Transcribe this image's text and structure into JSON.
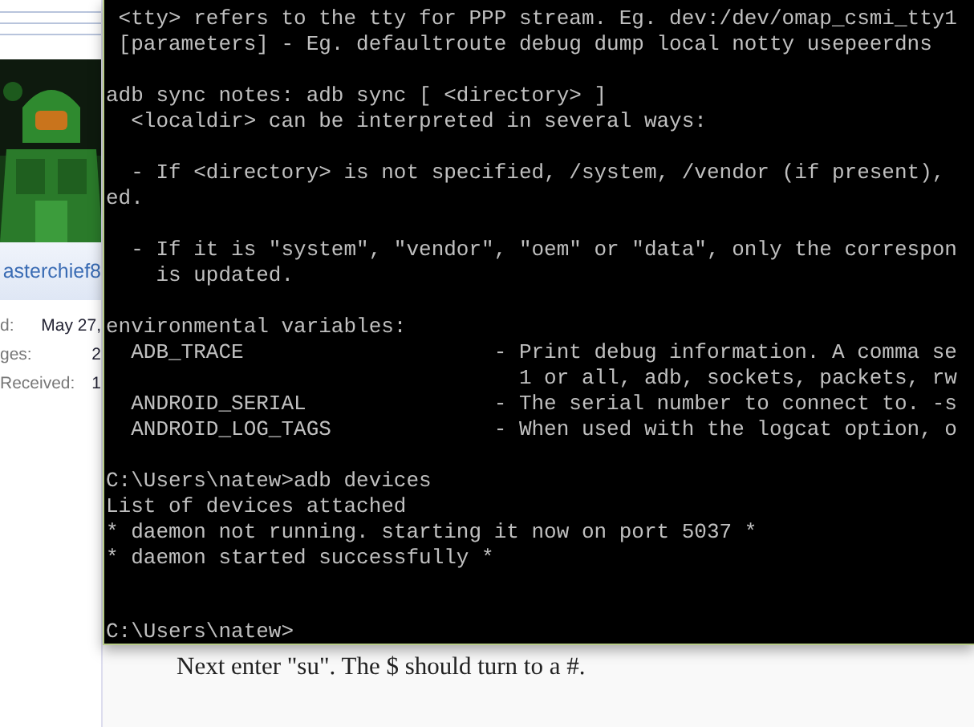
{
  "forum_sidebar": {
    "username": "asterchief8",
    "stats": [
      {
        "label": "d:",
        "value": "May 27,"
      },
      {
        "label": "ges:",
        "value": "2"
      },
      {
        "label": "Received:",
        "value": "1"
      }
    ]
  },
  "terminal": {
    "blocks": [
      [
        " <tty> refers to the tty for PPP stream. Eg. dev:/dev/omap_csmi_tty1",
        " [parameters] - Eg. defaultroute debug dump local notty usepeerdns"
      ],
      [
        "adb sync notes: adb sync [ <directory> ]",
        "  <localdir> can be interpreted in several ways:"
      ],
      [
        "  - If <directory> is not specified, /system, /vendor (if present),",
        "ed."
      ],
      [
        "  - If it is \"system\", \"vendor\", \"oem\" or \"data\", only the correspon",
        "    is updated."
      ],
      [
        "environmental variables:",
        "  ADB_TRACE                    - Print debug information. A comma se",
        "                                 1 or all, adb, sockets, packets, rw",
        "  ANDROID_SERIAL               - The serial number to connect to. -s",
        "  ANDROID_LOG_TAGS             - When used with the logcat option, o"
      ],
      [
        "C:\\Users\\natew>adb devices",
        "List of devices attached",
        "* daemon not running. starting it now on port 5037 *",
        "* daemon started successfully *"
      ]
    ],
    "prompt": "C:\\Users\\natew>"
  },
  "post_text": [
    "Next enter \"su\". The $ should turn to a #."
  ]
}
